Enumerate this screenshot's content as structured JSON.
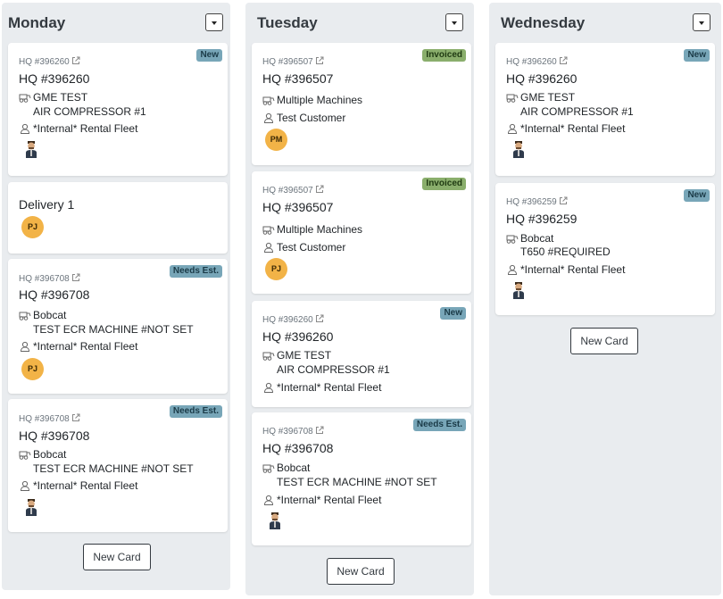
{
  "columns": [
    {
      "title": "Monday",
      "new_card_label": "New Card",
      "cards": [
        {
          "type": "job",
          "ref": "HQ #396260",
          "badge": "New",
          "badge_style": "new",
          "title": "HQ #396260",
          "machine_line1": "GME TEST",
          "machine_line2": "AIR COMPRESSOR #1",
          "customer": "*Internal* Rental Fleet",
          "assignee": "photo"
        },
        {
          "type": "delivery",
          "title": "Delivery 1",
          "assignee_initials": "PJ"
        },
        {
          "type": "job",
          "ref": "HQ #396708",
          "badge": "Needs Est.",
          "badge_style": "needs",
          "title": "HQ #396708",
          "machine_line1": "Bobcat",
          "machine_line2": "TEST ECR MACHINE #NOT SET",
          "customer": "*Internal* Rental Fleet",
          "assignee_initials": "PJ"
        },
        {
          "type": "job",
          "ref": "HQ #396708",
          "badge": "Needs Est.",
          "badge_style": "needs",
          "title": "HQ #396708",
          "machine_line1": "Bobcat",
          "machine_line2": "TEST ECR MACHINE #NOT SET",
          "customer": "*Internal* Rental Fleet",
          "assignee": "photo"
        }
      ]
    },
    {
      "title": "Tuesday",
      "new_card_label": "New Card",
      "cards": [
        {
          "type": "job",
          "ref": "HQ #396507",
          "badge": "Invoiced",
          "badge_style": "invoiced",
          "title": "HQ #396507",
          "machine_line1": "Multiple Machines",
          "customer": "Test Customer",
          "assignee_initials": "PM"
        },
        {
          "type": "job",
          "ref": "HQ #396507",
          "badge": "Invoiced",
          "badge_style": "invoiced",
          "title": "HQ #396507",
          "machine_line1": "Multiple Machines",
          "customer": "Test Customer",
          "assignee_initials": "PJ"
        },
        {
          "type": "job",
          "ref": "HQ #396260",
          "badge": "New",
          "badge_style": "new",
          "title": "HQ #396260",
          "machine_line1": "GME TEST",
          "machine_line2": "AIR COMPRESSOR #1",
          "customer": "*Internal* Rental Fleet"
        },
        {
          "type": "job",
          "ref": "HQ #396708",
          "badge": "Needs Est.",
          "badge_style": "needs",
          "title": "HQ #396708",
          "machine_line1": "Bobcat",
          "machine_line2": "TEST ECR MACHINE #NOT SET",
          "customer": "*Internal* Rental Fleet",
          "assignee": "photo"
        }
      ]
    },
    {
      "title": "Wednesday",
      "new_card_label": "New Card",
      "cards": [
        {
          "type": "job",
          "ref": "HQ #396260",
          "badge": "New",
          "badge_style": "new",
          "title": "HQ #396260",
          "machine_line1": "GME TEST",
          "machine_line2": "AIR COMPRESSOR #1",
          "customer": "*Internal* Rental Fleet",
          "assignee": "photo"
        },
        {
          "type": "job",
          "ref": "HQ #396259",
          "badge": "New",
          "badge_style": "new",
          "title": "HQ #396259",
          "machine_line1": "Bobcat",
          "machine_line2": "T650 #REQUIRED",
          "customer": "*Internal* Rental Fleet",
          "assignee": "photo"
        }
      ]
    }
  ],
  "colors": {
    "column_bg": "#e9ecef",
    "badge_new": "#78a6b8",
    "badge_invoiced": "#8aae6c",
    "avatar": "#f2b347"
  },
  "icons": {
    "ref_link": "external-link-icon",
    "machine": "machine-icon",
    "customer": "user-icon",
    "toggle": "chevron-down-icon"
  }
}
